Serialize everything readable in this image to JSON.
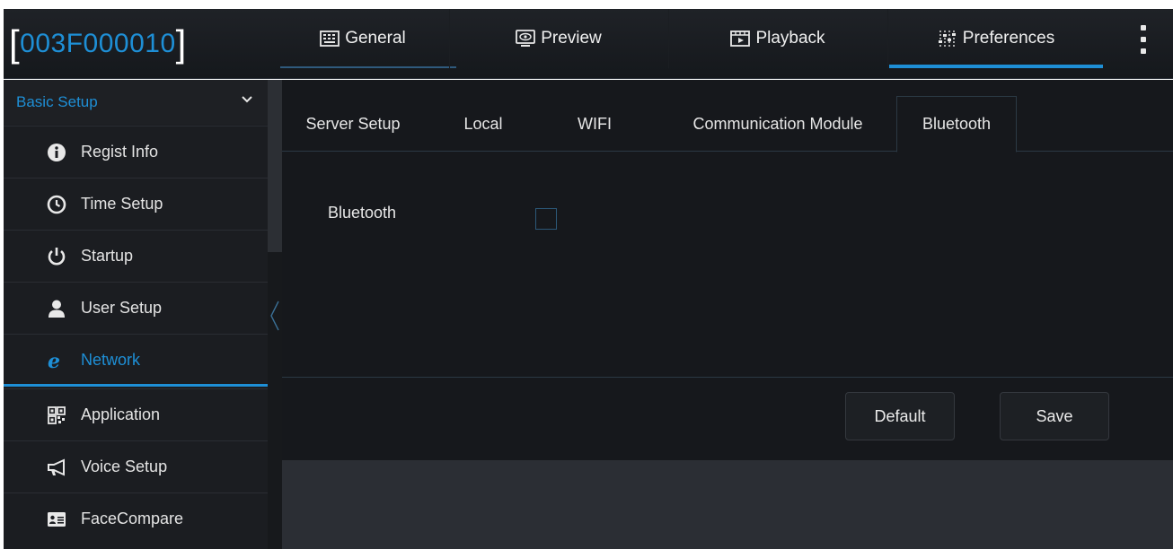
{
  "device_id": "003F000010",
  "nav": {
    "tabs": [
      {
        "label": "General",
        "icon": "keyboard-icon"
      },
      {
        "label": "Preview",
        "icon": "preview-eye-icon"
      },
      {
        "label": "Playback",
        "icon": "playback-film-icon"
      },
      {
        "label": "Preferences",
        "icon": "sliders-icon"
      }
    ],
    "active_tab": "Preferences",
    "menu_icon": "more-vertical-icon"
  },
  "sidebar": {
    "section_title": "Basic Setup",
    "section_icon": "chevron-down-icon",
    "items": [
      {
        "label": "Regist Info",
        "icon": "info-circle-icon"
      },
      {
        "label": "Time Setup",
        "icon": "clock-icon"
      },
      {
        "label": "Startup",
        "icon": "power-icon"
      },
      {
        "label": "User Setup",
        "icon": "user-icon"
      },
      {
        "label": "Network",
        "icon": "network-e-icon"
      },
      {
        "label": "Application",
        "icon": "qr-code-icon"
      },
      {
        "label": "Voice Setup",
        "icon": "megaphone-icon"
      },
      {
        "label": "FaceCompare",
        "icon": "id-card-icon"
      }
    ],
    "active_item": "Network",
    "collapse_icon": "chevron-left-icon"
  },
  "main": {
    "tabs": [
      "Server Setup",
      "Local",
      "WIFI",
      "Communication Module",
      "Bluetooth"
    ],
    "active_tab": "Bluetooth",
    "fields": {
      "bluetooth_label": "Bluetooth",
      "bluetooth_enabled": false
    },
    "buttons": {
      "default_label": "Default",
      "save_label": "Save"
    }
  },
  "colors": {
    "accent": "#1e8fd6",
    "background": "#16181c",
    "sidebar": "#1b1d21"
  }
}
